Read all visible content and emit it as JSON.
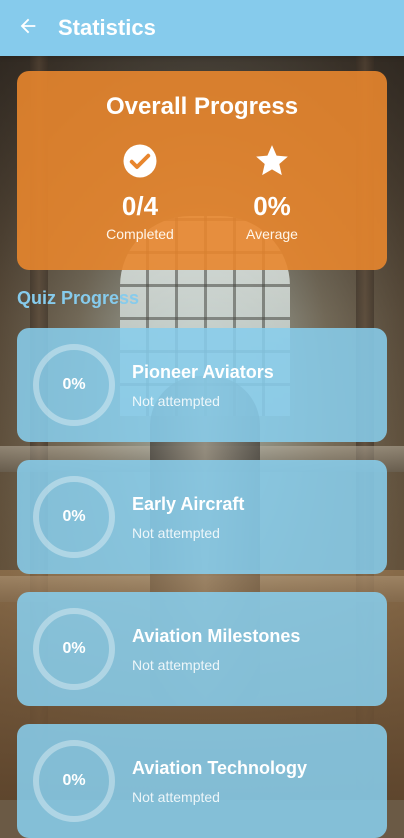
{
  "appbar": {
    "title": "Statistics",
    "back_icon": "arrow-left-icon"
  },
  "overall": {
    "title": "Overall Progress",
    "completed": {
      "icon": "check-circle-icon",
      "value": "0/4",
      "label": "Completed"
    },
    "average": {
      "icon": "star-icon",
      "value": "0%",
      "label": "Average"
    },
    "card_color": "#e8862e"
  },
  "quiz_section": {
    "title": "Quiz Progress",
    "items": [
      {
        "name": "Pioneer Aviators",
        "percent": "0%",
        "status": "Not attempted"
      },
      {
        "name": "Early Aircraft",
        "percent": "0%",
        "status": "Not attempted"
      },
      {
        "name": "Aviation Milestones",
        "percent": "0%",
        "status": "Not attempted"
      },
      {
        "name": "Aviation Technology",
        "percent": "0%",
        "status": "Not attempted"
      }
    ]
  },
  "colors": {
    "primary": "#86cbec",
    "accent": "#e8862e"
  }
}
